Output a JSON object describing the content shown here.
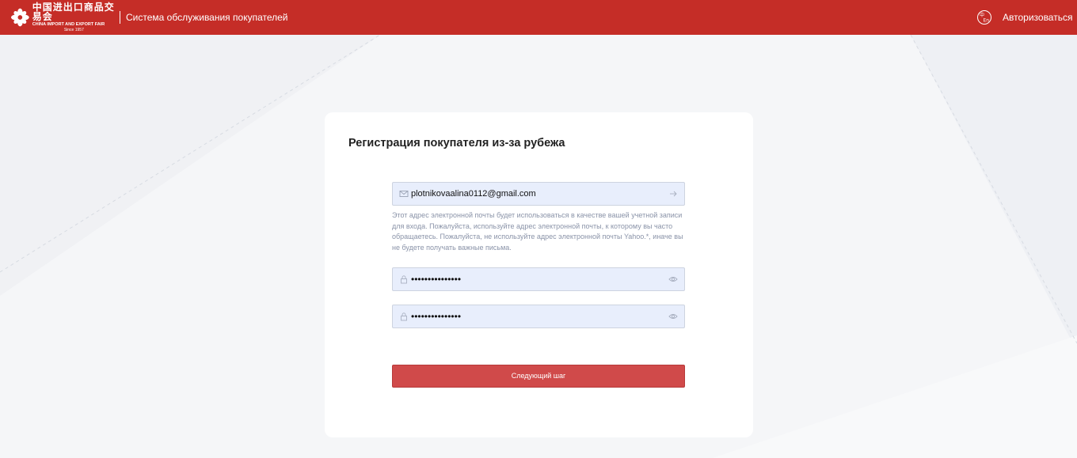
{
  "header": {
    "logo": {
      "cn_text": "中国进出口商品交易会",
      "en_text": "CHINA IMPORT AND EXPORT FAIR",
      "since": "Since 1957"
    },
    "system_title": "Система обслуживания покупателей",
    "language_icon": "cn-en-language-switch-icon",
    "login_label": "Авторизоваться"
  },
  "form": {
    "title": "Регистрация покупателя из-за рубежа",
    "email": {
      "value": "plotnikovaalina0112@gmail.com",
      "left_icon": "mail-icon",
      "right_icon": "arrow-right-icon"
    },
    "hint": "Этот адрес электронной почты будет использоваться в качестве вашей учетной записи для входа. Пожалуйста, используйте адрес электронной почты, к которому вы часто обращаетесь. Пожалуйста, не используйте адрес электронной почты Yahoo.*, иначе вы не будете получать важные письма.",
    "password": {
      "value": "•••••••••••••••",
      "left_icon": "lock-icon",
      "right_icon": "eye-icon"
    },
    "confirm_password": {
      "value": "•••••••••••••••",
      "left_icon": "lock-icon",
      "right_icon": "eye-icon"
    },
    "next_button_label": "Следующий шаг"
  },
  "colors": {
    "header_bg": "#c52d27",
    "button_bg": "#d04a4a",
    "field_bg": "#e8eefc"
  }
}
